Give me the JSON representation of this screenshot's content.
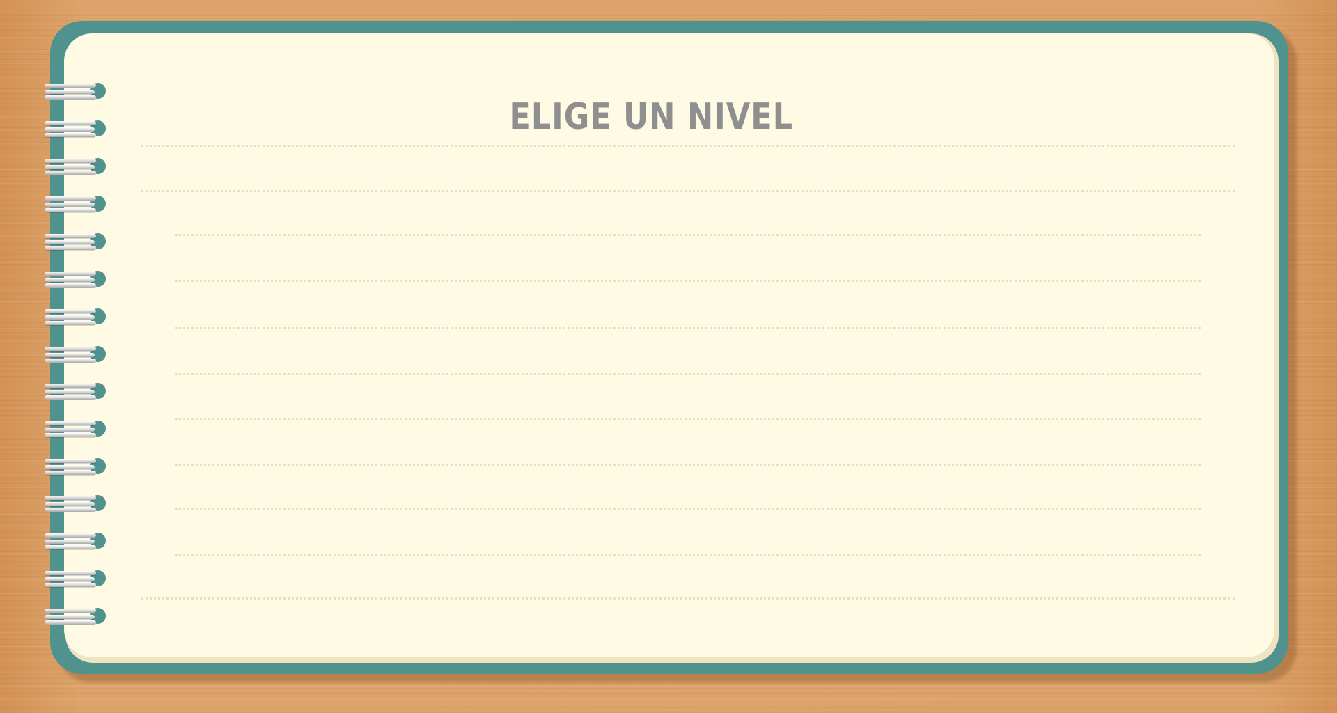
{
  "screen": {
    "title": "ELIGE UN NIVEL"
  },
  "colors": {
    "desk": "#d89c62",
    "cover": "#4f928e",
    "paper": "#fefae4",
    "title": "#8f8f8f",
    "dotted_lines": "#e6dfc4"
  },
  "icons": {
    "binding": "spiral-ring-icon"
  }
}
